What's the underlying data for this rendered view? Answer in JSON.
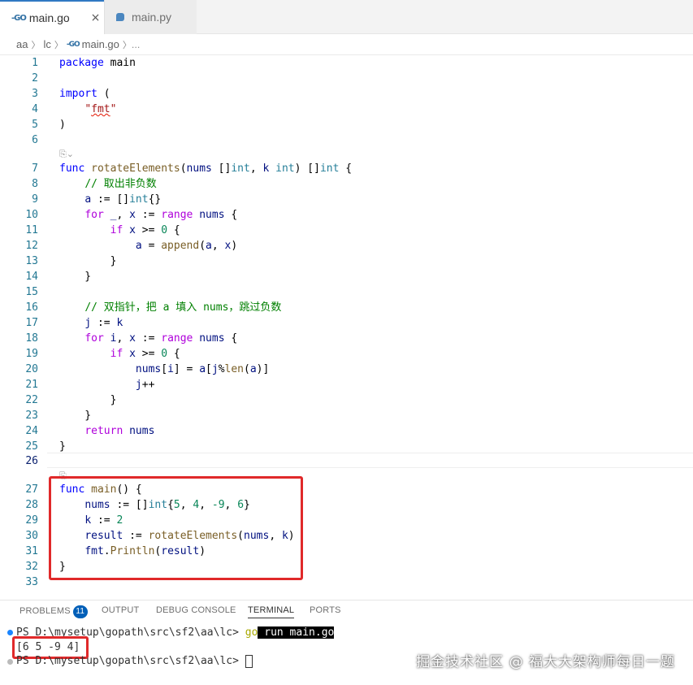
{
  "tabs": [
    {
      "label": "main.go",
      "icon": "go-icon",
      "active": true
    },
    {
      "label": "main.py",
      "icon": "python-icon",
      "active": false
    }
  ],
  "tab_close_glyph": "×",
  "go_glyph": "-GO",
  "breadcrumb": {
    "items": [
      "aa",
      "lc",
      "main.go"
    ]
  },
  "codelens_glyph": "⎘⌄",
  "editor": {
    "line_numbers": [
      "1",
      "2",
      "3",
      "4",
      "5",
      "6",
      "7",
      "8",
      "9",
      "10",
      "11",
      "12",
      "13",
      "14",
      "15",
      "16",
      "17",
      "18",
      "19",
      "20",
      "21",
      "22",
      "23",
      "24",
      "25",
      "26",
      "27",
      "28",
      "29",
      "30",
      "31",
      "32",
      "33"
    ]
  },
  "panel": {
    "tabs": [
      "PROBLEMS",
      "OUTPUT",
      "DEBUG CONSOLE",
      "TERMINAL",
      "PORTS"
    ],
    "problems_count": "11",
    "active_tab": "TERMINAL"
  },
  "terminal": {
    "prompt1": "PS D:\\mysetup\\gopath\\src\\sf2\\aa\\lc> ",
    "cmd_go": "go",
    "cmd_rest": " run main.go",
    "output": "[6 5 -9 4]",
    "prompt2": "PS D:\\mysetup\\gopath\\src\\sf2\\aa\\lc> "
  },
  "watermark": "掘金技术社区 @ 福大大架构师每日一题",
  "colors": {
    "accent": "#3079c3",
    "highlight_box": "#e0292a",
    "badge": "#005fb8"
  }
}
